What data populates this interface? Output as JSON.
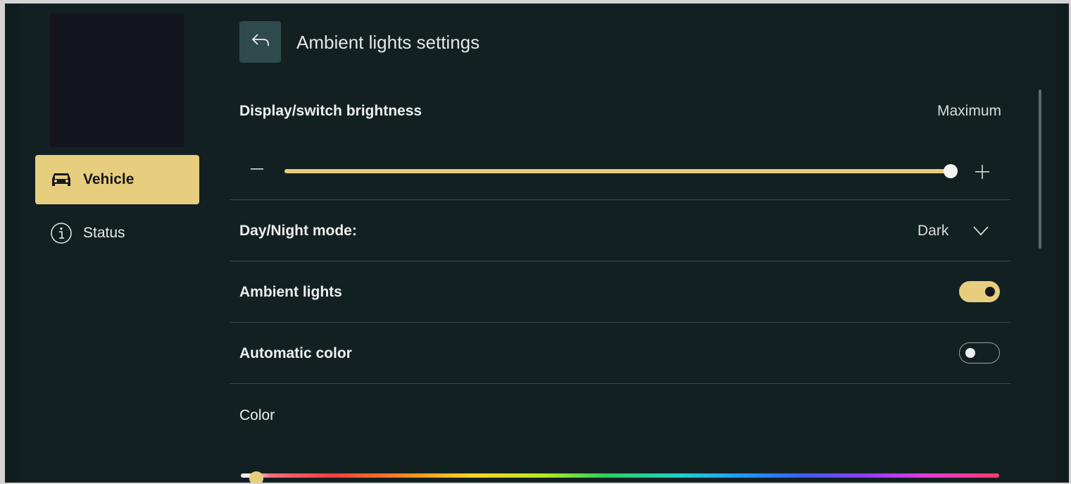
{
  "sidebar": {
    "items": [
      {
        "label": "Vehicle",
        "icon": "car-icon",
        "active": true
      },
      {
        "label": "Status",
        "icon": "info-icon",
        "active": false
      }
    ]
  },
  "header": {
    "back_icon": "back-arrow-icon",
    "title": "Ambient lights settings"
  },
  "settings": {
    "brightness": {
      "label": "Display/switch brightness",
      "value_text": "Maximum",
      "level": 1.0,
      "minus_icon": "minus-icon",
      "plus_icon": "plus-icon"
    },
    "day_night": {
      "label": "Day/Night mode:",
      "value": "Dark",
      "icon": "chevron-down-icon"
    },
    "ambient_lights": {
      "label": "Ambient lights",
      "enabled": true
    },
    "automatic_color": {
      "label": "Automatic color",
      "enabled": false
    },
    "color": {
      "label": "Color",
      "hue_position": 0.02
    }
  },
  "colors": {
    "accent": "#e7cd7e",
    "background": "#122022",
    "divider": "#3a4b4d",
    "button": "#2f4a4d"
  }
}
